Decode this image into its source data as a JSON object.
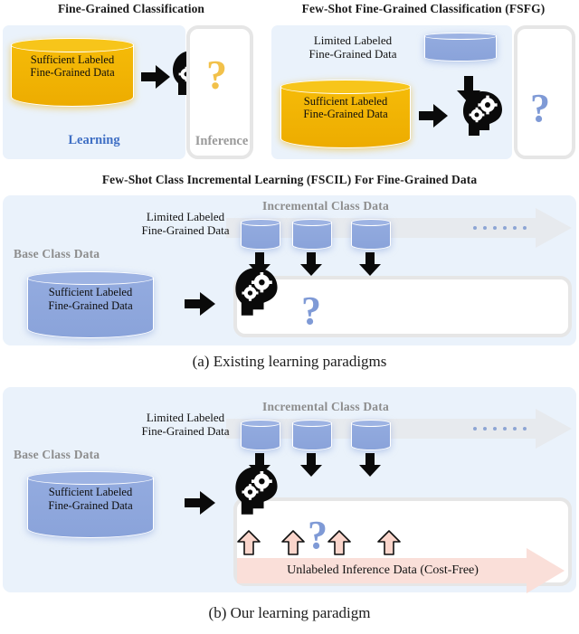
{
  "figure": {
    "panel_a_caption": "(a) Existing learning paradigms",
    "panel_b_caption": "(b) Our learning paradigm"
  },
  "colors": {
    "panel_background": "#eaf2fb",
    "yellow_cylinder": "#f2b705",
    "blue_cylinder": "#8fa8dd",
    "pink_band": "#fadfd9",
    "grey_band": "#e7eaee",
    "learning_blue": "#3f6fc4",
    "inference_grey": "#9a9a9a",
    "section_label_grey": "#8d8d8d"
  },
  "top_left": {
    "title": "Fine-Grained Classification",
    "dataset_label": "Sufficient Labeled\nFine-Grained Data",
    "dataset_line1": "Sufficient Labeled",
    "dataset_line2": "Fine-Grained Data",
    "learning_label": "Learning",
    "inference_label": "Inference"
  },
  "top_right": {
    "title": "Few-Shot Fine-Grained Classification (FSFG)",
    "limited_line1": "Limited Labeled",
    "limited_line2": "Fine-Grained Data",
    "sufficient_line1": "Sufficient Labeled",
    "sufficient_line2": "Fine-Grained Data"
  },
  "panel_a": {
    "title": "Few-Shot Class Incremental Learning (FSCIL) For Fine-Grained Data",
    "limited_line1": "Limited Labeled",
    "limited_line2": "Fine-Grained Data",
    "incremental_label": "Incremental Class Data",
    "base_class_label": "Base Class Data",
    "sufficient_line1": "Sufficient Labeled",
    "sufficient_line2": "Fine-Grained Data",
    "stream_dots": 6,
    "incremental_cylinders": 3
  },
  "panel_b": {
    "limited_line1": "Limited Labeled",
    "limited_line2": "Fine-Grained Data",
    "incremental_label": "Incremental Class Data",
    "base_class_label": "Base Class Data",
    "sufficient_line1": "Sufficient Labeled",
    "sufficient_line2": "Fine-Grained Data",
    "unlabeled_band_label": "Unlabeled Inference Data (Cost-Free)",
    "stream_dots": 6,
    "incremental_cylinders": 3,
    "up_arrows": 4
  }
}
